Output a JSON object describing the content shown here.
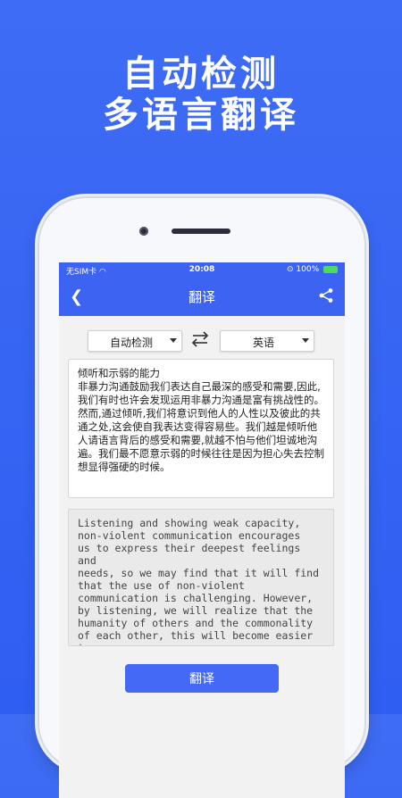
{
  "promo": {
    "line1": "自动检测",
    "line2": "多语言翻译"
  },
  "status_bar": {
    "carrier": "无SIM卡",
    "time": "20:08",
    "battery": "100%"
  },
  "nav": {
    "title": "翻译",
    "back_icon": "chevron-left-icon",
    "share_icon": "share-icon"
  },
  "languages": {
    "source": "自动检测",
    "target": "英语",
    "swap_icon": "swap-arrows-icon"
  },
  "input_text": "倾听和示弱的能力\n非暴力沟通鼓励我们表达自己最深的感受和需要,因此,我们有时也许会发现运用非暴力沟通是富有挑战性的。然而,通过倾听,我们将意识到他人的人性以及彼此的共通之处,这会使自我表达变得容易些。我们越是倾听他人请语言背后的感受和需要,就越不怕与他们坦诚地沟遍。我们最不愿意示弱的时候往往是因为担心失去控制想显得强硬的时候。",
  "output_text": "Listening and showing weak capacity,\nnon-violent communication encourages\nus to express their deepest feelings and\nneeds, so we may find that it will find\nthat the use of non-violent\ncommunication is challenging. However,\nby listening, we will realize that the\nhumanity of others and the commonality\nof each other, this will become easier to\nexpress. The more we listen to the\nfeelings and needs behind others asked",
  "translate_button": "翻译",
  "colors": {
    "background": "#3162f2",
    "app_bar": "#3d63f2",
    "button": "#4469f4"
  }
}
